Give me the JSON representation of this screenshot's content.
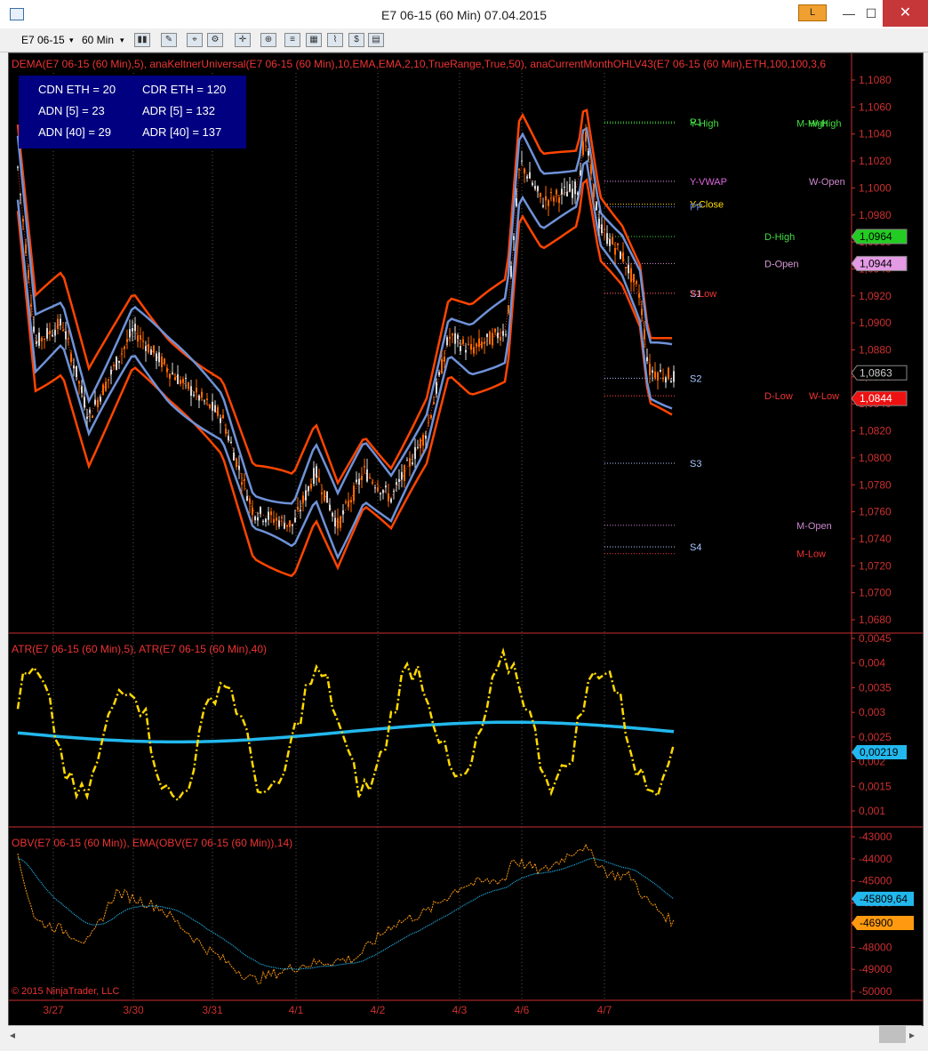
{
  "window": {
    "title": "E7 06-15 (60 Min)  07.04.2015",
    "badge": "L",
    "minimize": "—",
    "maximize": "☐",
    "close": "✕"
  },
  "toolbar": {
    "instrument": "E7 06-15",
    "interval": "60 Min",
    "dropdown_icon": "chevron-down-icon"
  },
  "info_box": {
    "bg": "#000080",
    "cdn_eth": "CDN ETH = 20",
    "cdr_eth": "CDR ETH = 120",
    "adn5": "ADN [5] = 23",
    "adr5": "ADR [5] = 132",
    "adn40": "ADN [40] = 29",
    "adr40": "ADR [40] = 137"
  },
  "panels": {
    "price": {
      "header": "DEMA(E7  06-15 (60 Min),5), anaKeltnerUniversal(E7  06-15 (60 Min),10,EMA,EMA,2,10,TrueRange,True,50), anaCurrentMonthOHLV43(E7  06-15 (60 Min),ETH,100,100,3,6",
      "axis_ticks": [
        "1,1080",
        "1,1060",
        "1,1040",
        "1,1020",
        "1,1000",
        "1,0980",
        "1,0960",
        "1,0940",
        "1,0920",
        "1,0900",
        "1,0880",
        "1,0860",
        "1,0840",
        "1,0820",
        "1,0800",
        "1,0780",
        "1,0760",
        "1,0740",
        "1,0720",
        "1,0700",
        "1,0680"
      ],
      "tags": [
        {
          "text": "1,0964",
          "bg": "#22cc22",
          "fg": "#000000"
        },
        {
          "text": "1,0944",
          "bg": "#e49ae4",
          "fg": "#000000"
        },
        {
          "text": "1,0863",
          "bg": "#000000",
          "fg": "#cccccc"
        },
        {
          "text": "1,0844",
          "bg": "#ee1111",
          "fg": "#ffffff"
        }
      ],
      "level_labels": [
        {
          "text": "R1",
          "color": "#44dd44"
        },
        {
          "text": "Y-High",
          "color": "#44dd44"
        },
        {
          "text": "M-High",
          "color": "#44dd44"
        },
        {
          "text": "W-High",
          "color": "#44dd44"
        },
        {
          "text": "Y-VWAP",
          "color": "#dd66dd"
        },
        {
          "text": "W-Open",
          "color": "#cc88cc"
        },
        {
          "text": "Y-Close",
          "color": "#ffdd00"
        },
        {
          "text": "PP",
          "color": "#6688dd"
        },
        {
          "text": "D-High",
          "color": "#44dd44"
        },
        {
          "text": "D-Open",
          "color": "#d99ad9"
        },
        {
          "text": "S1",
          "color": "#ccccff"
        },
        {
          "text": "Y-Low",
          "color": "#ee3333"
        },
        {
          "text": "S2",
          "color": "#a8c8ff"
        },
        {
          "text": "D-Low",
          "color": "#ee3333"
        },
        {
          "text": "W-Low",
          "color": "#ee3333"
        },
        {
          "text": "S3",
          "color": "#a8c8ff"
        },
        {
          "text": "M-Open",
          "color": "#cc88cc"
        },
        {
          "text": "S4",
          "color": "#a8c8ff"
        },
        {
          "text": "M-Low",
          "color": "#ee3333"
        }
      ]
    },
    "atr": {
      "header": "ATR(E7 06-15 (60 Min),5), ATR(E7 06-15 (60 Min),40)",
      "axis_ticks": [
        "0,0045",
        "0,004",
        "0,0035",
        "0,003",
        "0,0025",
        "0,002",
        "0,0015",
        "0,001"
      ],
      "tag": {
        "text": "0,00219",
        "bg": "#22b8ee",
        "fg": "#000000"
      },
      "colors": {
        "atr5": "#ffd800",
        "atr40": "#22b8ee"
      }
    },
    "obv": {
      "header": "OBV(E7 06-15 (60 Min)), EMA(OBV(E7 06-15 (60 Min)),14)",
      "axis_ticks": [
        "-43000",
        "-44000",
        "-45000",
        "-46000",
        "-47000",
        "-48000",
        "-49000",
        "-50000"
      ],
      "tags": [
        {
          "text": "-45809,64",
          "bg": "#22b8ee",
          "fg": "#000000"
        },
        {
          "text": "-46900",
          "bg": "#ff9a10",
          "fg": "#000000"
        }
      ],
      "copyright": "© 2015 NinjaTrader, LLC"
    }
  },
  "x_axis": [
    "3/27",
    "3/30",
    "3/31",
    "4/1",
    "4/2",
    "4/3",
    "4/6",
    "4/7"
  ],
  "colors": {
    "header_text": "#ee3333",
    "axis_text": "#cc3030",
    "grid": "#555555",
    "panel_sep": "#cc3030",
    "keltner": "#ff4500",
    "bollinger": "#6f92d8",
    "candle_up": "#d8d8d8",
    "candle_down": "#ff6a00",
    "obv": "#ff9a10",
    "obv_ema": "#22b8ee"
  }
}
